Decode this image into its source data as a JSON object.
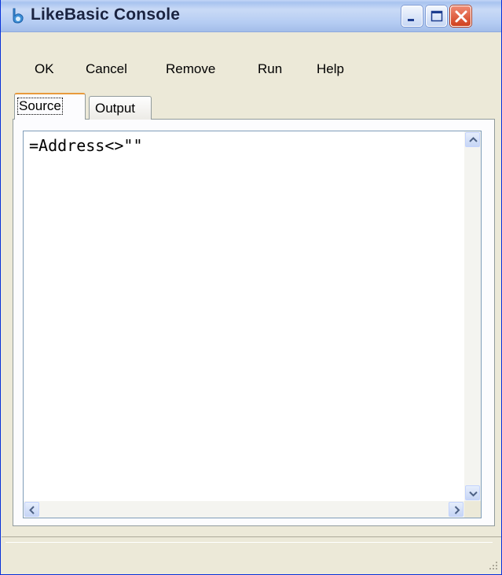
{
  "window": {
    "title": "LikeBasic Console",
    "icon": "likebasic-app-icon",
    "controls": {
      "minimize": "minimize-icon",
      "maximize": "maximize-icon",
      "close": "close-icon"
    }
  },
  "menu": {
    "items": [
      "OK",
      "Cancel",
      "Remove",
      "Run",
      "Help"
    ]
  },
  "tabs": [
    {
      "label": "Source",
      "selected": true
    },
    {
      "label": "Output",
      "selected": false
    }
  ],
  "editor": {
    "content": "=Address<>\"\""
  },
  "colors": {
    "title_text": "#1a2340",
    "window_face": "#ece9d8",
    "active_tab_accent": "#e89a3c",
    "close_button": "#d0401c"
  }
}
